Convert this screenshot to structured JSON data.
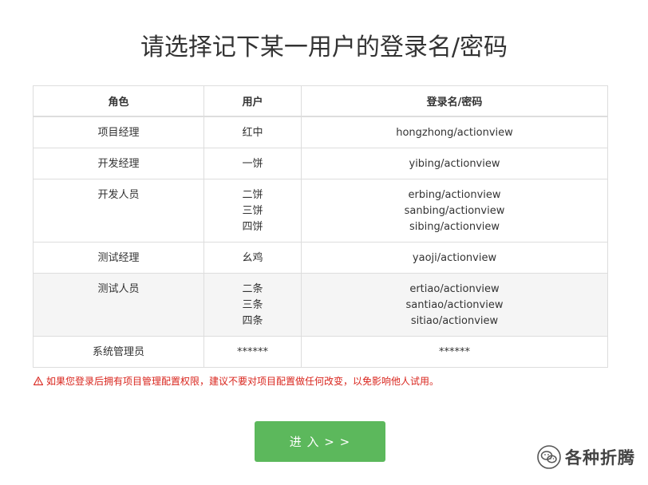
{
  "page": {
    "title": "请选择记下某一用户的登录名/密码"
  },
  "table": {
    "headers": {
      "role": "角色",
      "user": "用户",
      "login": "登录名/密码"
    },
    "rows": [
      {
        "role": "项目经理",
        "users": [
          "红中"
        ],
        "logins": [
          "hongzhong/actionview"
        ],
        "striped": false
      },
      {
        "role": "开发经理",
        "users": [
          "一饼"
        ],
        "logins": [
          "yibing/actionview"
        ],
        "striped": false
      },
      {
        "role": "开发人员",
        "users": [
          "二饼",
          "三饼",
          "四饼"
        ],
        "logins": [
          "erbing/actionview",
          "sanbing/actionview",
          "sibing/actionview"
        ],
        "striped": false
      },
      {
        "role": "测试经理",
        "users": [
          "幺鸡"
        ],
        "logins": [
          "yaoji/actionview"
        ],
        "striped": false
      },
      {
        "role": "测试人员",
        "users": [
          "二条",
          "三条",
          "四条"
        ],
        "logins": [
          "ertiao/actionview",
          "santiao/actionview",
          "sitiao/actionview"
        ],
        "striped": true
      },
      {
        "role": "系统管理员",
        "users": [
          "******"
        ],
        "logins": [
          "******"
        ],
        "striped": false
      }
    ]
  },
  "warning": {
    "icon": "warning-icon",
    "text": "如果您登录后拥有项目管理配置权限，建议不要对项目配置做任何改变，以免影响他人试用。",
    "color": "#d9251d"
  },
  "enter_button": {
    "label": "进 入 > >",
    "color": "#5cb85c"
  },
  "watermark": {
    "icon": "wechat-icon",
    "text": "各种折腾"
  }
}
